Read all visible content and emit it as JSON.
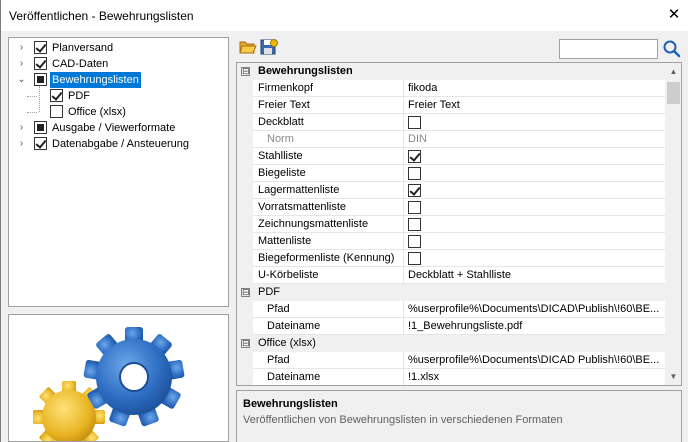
{
  "window": {
    "title": "Veröffentlichen - Bewehrungslisten"
  },
  "tree": {
    "items": [
      {
        "label": "Planversand",
        "state": "checked",
        "level": 0,
        "expander": "›"
      },
      {
        "label": "CAD-Daten",
        "state": "checked",
        "level": 0,
        "expander": "›"
      },
      {
        "label": "Bewehrungslisten",
        "state": "partial",
        "level": 0,
        "expander": "⌄",
        "selected": true
      },
      {
        "label": "PDF",
        "state": "checked",
        "level": 1
      },
      {
        "label": "Office (xlsx)",
        "state": "unchecked",
        "level": 1
      },
      {
        "label": "Ausgabe / Viewerformate",
        "state": "partial",
        "level": 0,
        "expander": "›"
      },
      {
        "label": "Datenabgabe / Ansteuerung",
        "state": "checked",
        "level": 0,
        "expander": "›"
      }
    ]
  },
  "toolbar": {
    "open_icon": "folder-open-icon",
    "save_icon": "save-icon"
  },
  "search": {
    "placeholder": "",
    "value": ""
  },
  "grid": {
    "rows": [
      {
        "type": "category",
        "name": "Bewehrungslisten",
        "box": "⊟"
      },
      {
        "type": "prop",
        "name": "Firmenkopf",
        "value": "fikoda"
      },
      {
        "type": "prop",
        "name": "Freier Text",
        "value": "Freier Text"
      },
      {
        "type": "check",
        "name": "Deckblatt",
        "checked": false
      },
      {
        "type": "prop",
        "name": "Norm",
        "value": "DIN",
        "indent": true,
        "disabled": true
      },
      {
        "type": "check",
        "name": "Stahlliste",
        "checked": true
      },
      {
        "type": "check",
        "name": "Biegeliste",
        "checked": false
      },
      {
        "type": "check",
        "name": "Lagermattenliste",
        "checked": true
      },
      {
        "type": "check",
        "name": "Vorratsmattenliste",
        "checked": false
      },
      {
        "type": "check",
        "name": "Zeichnungsmattenliste",
        "checked": false
      },
      {
        "type": "check",
        "name": "Mattenliste",
        "checked": false
      },
      {
        "type": "check",
        "name": "Biegeformenliste (Kennung)",
        "checked": false
      },
      {
        "type": "prop",
        "name": "U-Körbeliste",
        "value": "Deckblatt + Stahlliste"
      },
      {
        "type": "subcategory",
        "name": "PDF",
        "box": "⊟"
      },
      {
        "type": "prop",
        "name": "Pfad",
        "value": "%userprofile%\\Documents\\DICAD\\Publish\\!60\\BE...",
        "indent": true
      },
      {
        "type": "prop",
        "name": "Dateiname",
        "value": "!1_Bewehrungsliste.pdf",
        "indent": true
      },
      {
        "type": "subcategory",
        "name": "Office (xlsx)",
        "box": "⊟"
      },
      {
        "type": "prop",
        "name": "Pfad",
        "value": "%userprofile%\\Documents\\DICAD Publish\\!60\\BE...",
        "indent": true
      },
      {
        "type": "prop",
        "name": "Dateiname",
        "value": "!1.xlsx",
        "indent": true
      }
    ]
  },
  "description": {
    "title": "Bewehrungslisten",
    "text": "Veröffentlichen von Bewehrungslisten in verschiedenen Formaten"
  }
}
